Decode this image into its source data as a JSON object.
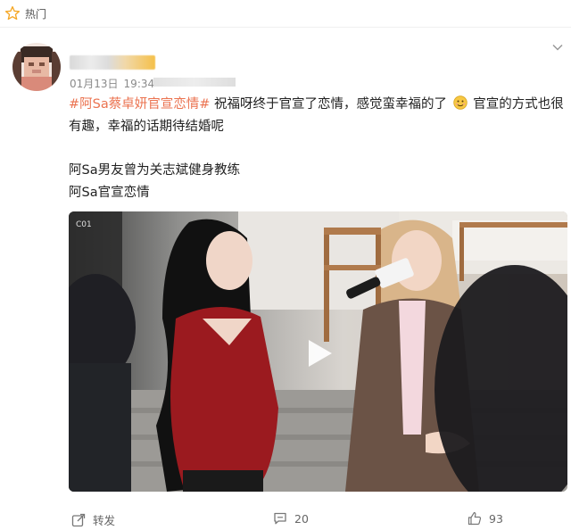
{
  "header": {
    "label": "热门",
    "icon": "star-icon"
  },
  "post": {
    "date": "01月13日",
    "time": "19:34",
    "hashtag": "#阿Sa蔡卓妍官宣恋情#",
    "text_part1": "祝福呀终于官宣了恋情，感觉蛮幸福的了",
    "text_part2": "官宣的方式也很有趣，幸福的话期待结婚呢",
    "line2": "阿Sa男友曾为关志斌健身教练",
    "line3": "阿Sa官宣恋情"
  },
  "video": {
    "icon": "play-icon"
  },
  "actions": {
    "repost_label": "转发",
    "comment_count": "20",
    "like_count": "93"
  },
  "colors": {
    "hashtag": "#eb7350",
    "accent_star": "#f5a623"
  }
}
